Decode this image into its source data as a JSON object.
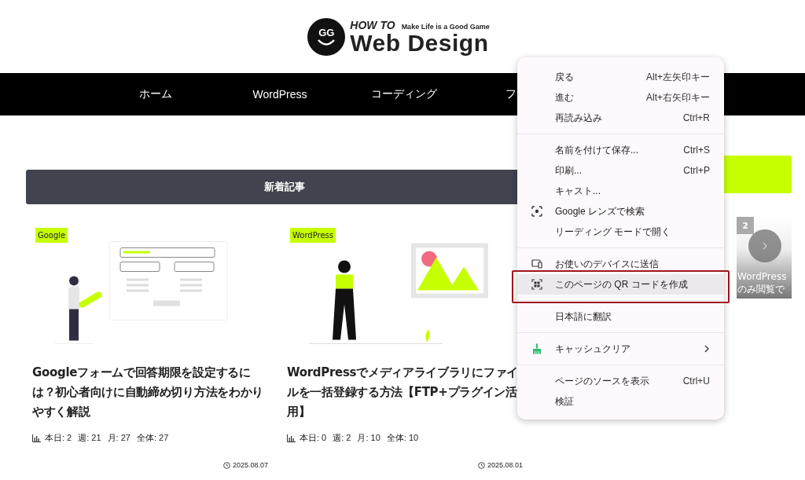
{
  "logo": {
    "small_title": "HOW TO",
    "tagline": "Make Life is a Good Game",
    "title": "Web Design",
    "mark": "GG"
  },
  "nav": {
    "items": [
      {
        "label": "ホーム"
      },
      {
        "label": "WordPress"
      },
      {
        "label": "コーディング"
      },
      {
        "label": "フ"
      }
    ]
  },
  "section": {
    "heading": "新着記事"
  },
  "articles": [
    {
      "category": "Google",
      "title": "Googleフォームで回答期限を設定するには？初心者向けに自動締め切り方法をわかりやすく解説",
      "stats": [
        "本日: 2",
        "週: 21",
        "月: 27",
        "全体: 27"
      ],
      "date": "2025.08.07"
    },
    {
      "category": "WordPress",
      "title": "WordPressでメディアライブラリにファイルを一括登録する方法【FTP+プラグイン活用】",
      "stats": [
        "本日: 0",
        "週: 2",
        "月: 10",
        "全体: 10"
      ],
      "date": "2025.08.01"
    }
  ],
  "ranking": {
    "rank": "2",
    "caption_lines": [
      "WordPress",
      "のみ閲覧で"
    ]
  },
  "context_menu": {
    "groups": [
      [
        {
          "label": "戻る",
          "shortcut": "Alt+左矢印キー",
          "selected": false,
          "submenu": false
        },
        {
          "label": "進む",
          "shortcut": "Alt+右矢印キー",
          "selected": false,
          "submenu": false
        },
        {
          "label": "再読み込み",
          "shortcut": "Ctrl+R",
          "selected": false,
          "submenu": false
        }
      ],
      [
        {
          "label": "名前を付けて保存...",
          "shortcut": "Ctrl+S",
          "selected": false,
          "submenu": false
        },
        {
          "label": "印刷...",
          "shortcut": "Ctrl+P",
          "selected": false,
          "submenu": false
        },
        {
          "label": "キャスト...",
          "selected": false,
          "submenu": false
        },
        {
          "label": "Google レンズで検索",
          "selected": false,
          "submenu": false
        },
        {
          "label": "リーディング モードで開く",
          "selected": false,
          "submenu": false
        }
      ],
      [
        {
          "label": "お使いのデバイスに送信",
          "selected": false,
          "submenu": false
        },
        {
          "label": "このページの QR コードを作成",
          "selected": true,
          "submenu": false,
          "highlighted": true
        }
      ],
      [
        {
          "label": "日本語に翻訳",
          "selected": false,
          "submenu": false
        }
      ],
      [
        {
          "label": "キャッシュクリア",
          "selected": false,
          "submenu": true
        }
      ],
      [
        {
          "label": "ページのソースを表示",
          "shortcut": "Ctrl+U",
          "selected": false,
          "submenu": false
        },
        {
          "label": "検証",
          "selected": false,
          "submenu": false
        }
      ]
    ]
  }
}
